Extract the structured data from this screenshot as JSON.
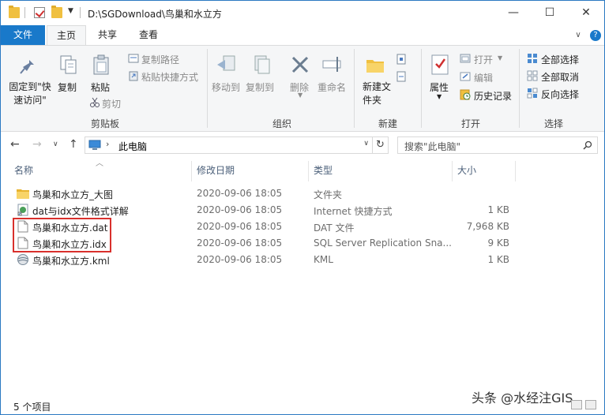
{
  "window": {
    "title": "D:\\SGDownload\\鸟巢和水立方"
  },
  "window_controls": {
    "minimize": "—",
    "maximize": "☐",
    "close": "✕"
  },
  "tabs": {
    "file": "文件",
    "home": "主页",
    "share": "共享",
    "view": "查看"
  },
  "ribbon": {
    "clipboard": {
      "pin": "固定到\"快速访问\"",
      "copy": "复制",
      "paste": "粘贴",
      "copy_path": "复制路径",
      "paste_shortcut": "粘贴快捷方式",
      "cut": "剪切",
      "label": "剪贴板"
    },
    "organize": {
      "move_to": "移动到",
      "copy_to": "复制到",
      "delete": "删除",
      "rename": "重命名",
      "label": "组织"
    },
    "new": {
      "new_folder": "新建文件夹",
      "label": "新建"
    },
    "open": {
      "properties": "属性",
      "open": "打开",
      "edit": "编辑",
      "history": "历史记录",
      "label": "打开"
    },
    "select": {
      "select_all": "全部选择",
      "select_none": "全部取消",
      "invert": "反向选择",
      "label": "选择"
    }
  },
  "address": {
    "path": "此电脑",
    "search_placeholder": "搜索\"此电脑\""
  },
  "columns": {
    "name": "名称",
    "date": "修改日期",
    "type": "类型",
    "size": "大小"
  },
  "files": [
    {
      "icon": "folder-icon",
      "name": "鸟巢和水立方_大图",
      "date": "2020-09-06 18:05",
      "type": "文件夹",
      "size": ""
    },
    {
      "icon": "internet-shortcut-icon",
      "name": "dat与idx文件格式详解",
      "date": "2020-09-06 18:05",
      "type": "Internet 快捷方式",
      "size": "1 KB"
    },
    {
      "icon": "file-icon",
      "name": "鸟巢和水立方.dat",
      "date": "2020-09-06 18:05",
      "type": "DAT 文件",
      "size": "7,968 KB"
    },
    {
      "icon": "file-icon",
      "name": "鸟巢和水立方.idx",
      "date": "2020-09-06 18:05",
      "type": "SQL Server Replication Sna...",
      "size": "9 KB"
    },
    {
      "icon": "kml-icon",
      "name": "鸟巢和水立方.kml",
      "date": "2020-09-06 18:05",
      "type": "KML",
      "size": "1 KB"
    }
  ],
  "status": {
    "count": "5 个项目"
  },
  "watermark": "头条 @水经注GIS",
  "colors": {
    "accent": "#1979ca",
    "highlight": "#d9302c",
    "folder": "#f0c040"
  }
}
